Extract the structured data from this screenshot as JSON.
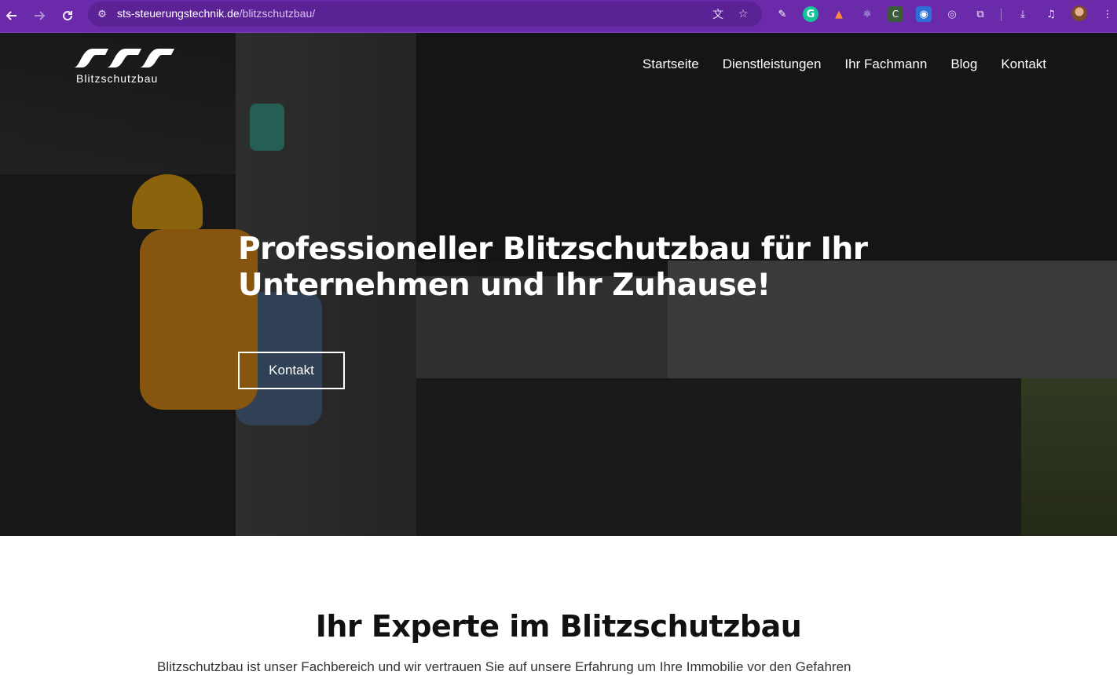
{
  "browser": {
    "url_host": "sts-steuerungstechnik.de",
    "url_path": "/blitzschutzbau/",
    "icons": {
      "back": "arrow-left-icon",
      "forward": "arrow-right-icon",
      "reload": "reload-icon",
      "site_info": "site-info-icon",
      "translate": "translate-icon",
      "bookmark": "star-icon",
      "downloads": "download-icon",
      "media": "media-control-icon",
      "menu": "kebab-menu-icon"
    },
    "extensions": [
      "eyedropper-icon",
      "grammarly-icon",
      "fox-extension-icon",
      "react-devtools-icon",
      "c-extension-icon",
      "screen-capture-icon",
      "target-extension-icon",
      "puzzle-icon"
    ],
    "theme_color": "#6a2aa9"
  },
  "site": {
    "logo_text": "Blitzschutzbau",
    "nav": [
      "Startseite",
      "Dienstleistungen",
      "Ihr Fachmann",
      "Blog",
      "Kontakt"
    ],
    "hero": {
      "title_line1": "Professioneller Blitzschutzbau für Ihr",
      "title_line2": "Unternehmen und Ihr Zuhause!",
      "button": "Kontakt"
    },
    "section": {
      "title": "Ihr Experte im Blitzschutzbau",
      "text": "Blitzschutzbau ist unser Fachbereich und wir vertrauen Sie auf unsere Erfahrung um Ihre Immobilie vor den Gefahren"
    }
  }
}
